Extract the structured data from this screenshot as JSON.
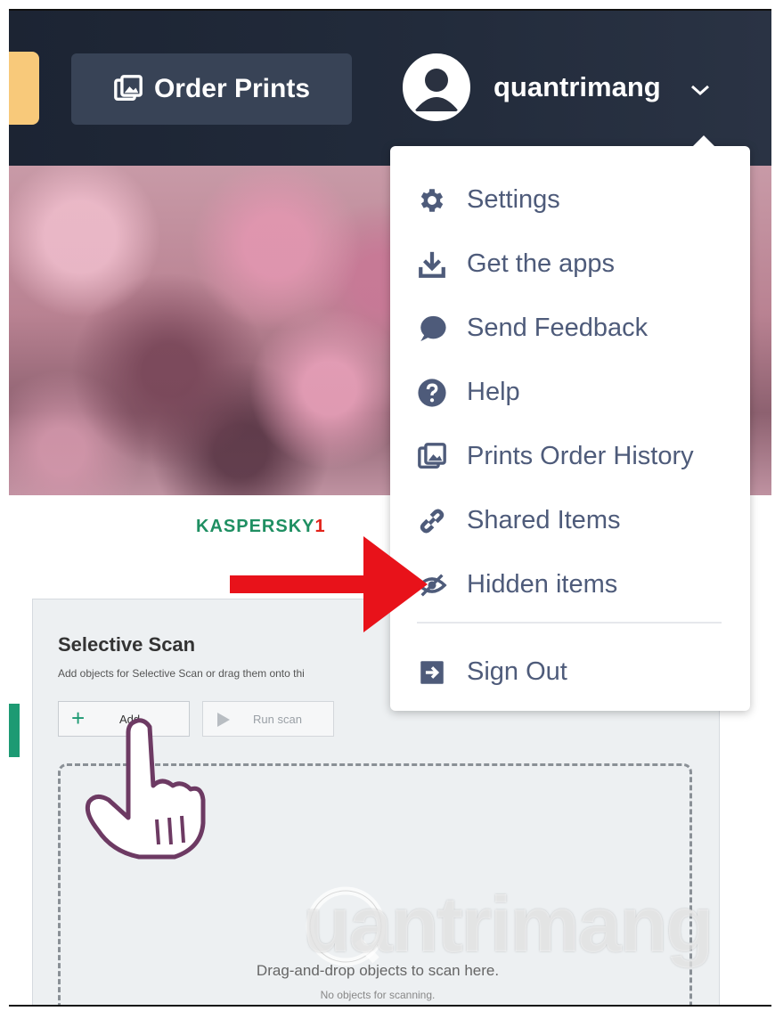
{
  "topbar": {
    "order_prints_label": "Order Prints",
    "username": "quantrimang"
  },
  "banner": {
    "kaspersky_logo": "KASPERSKY",
    "kaspersky_logo_suffix": "1"
  },
  "scan": {
    "title": "Selective Scan",
    "description": "Add objects for Selective Scan or drag them onto thi",
    "add_label": "Add...",
    "run_label": "Run scan",
    "drop_text": "Drag-and-drop objects to scan here.",
    "drop_subtext": "No objects for scanning."
  },
  "watermark": "uantrimang",
  "menu": {
    "items": [
      {
        "label": "Settings",
        "icon": "gear-icon"
      },
      {
        "label": "Get the apps",
        "icon": "download-icon"
      },
      {
        "label": "Send Feedback",
        "icon": "chat-bubble-icon"
      },
      {
        "label": "Help",
        "icon": "question-circle-icon"
      },
      {
        "label": "Prints Order History",
        "icon": "prints-icon"
      },
      {
        "label": "Shared Items",
        "icon": "link-icon"
      },
      {
        "label": "Hidden items",
        "icon": "eye-slash-icon"
      },
      {
        "label": "Sign Out",
        "icon": "sign-out-icon"
      }
    ]
  },
  "colors": {
    "topbar": "#222b3b",
    "menu_text": "#4e5b7a",
    "arrow": "#e8121a",
    "accent_yellow": "#f8c97a"
  }
}
